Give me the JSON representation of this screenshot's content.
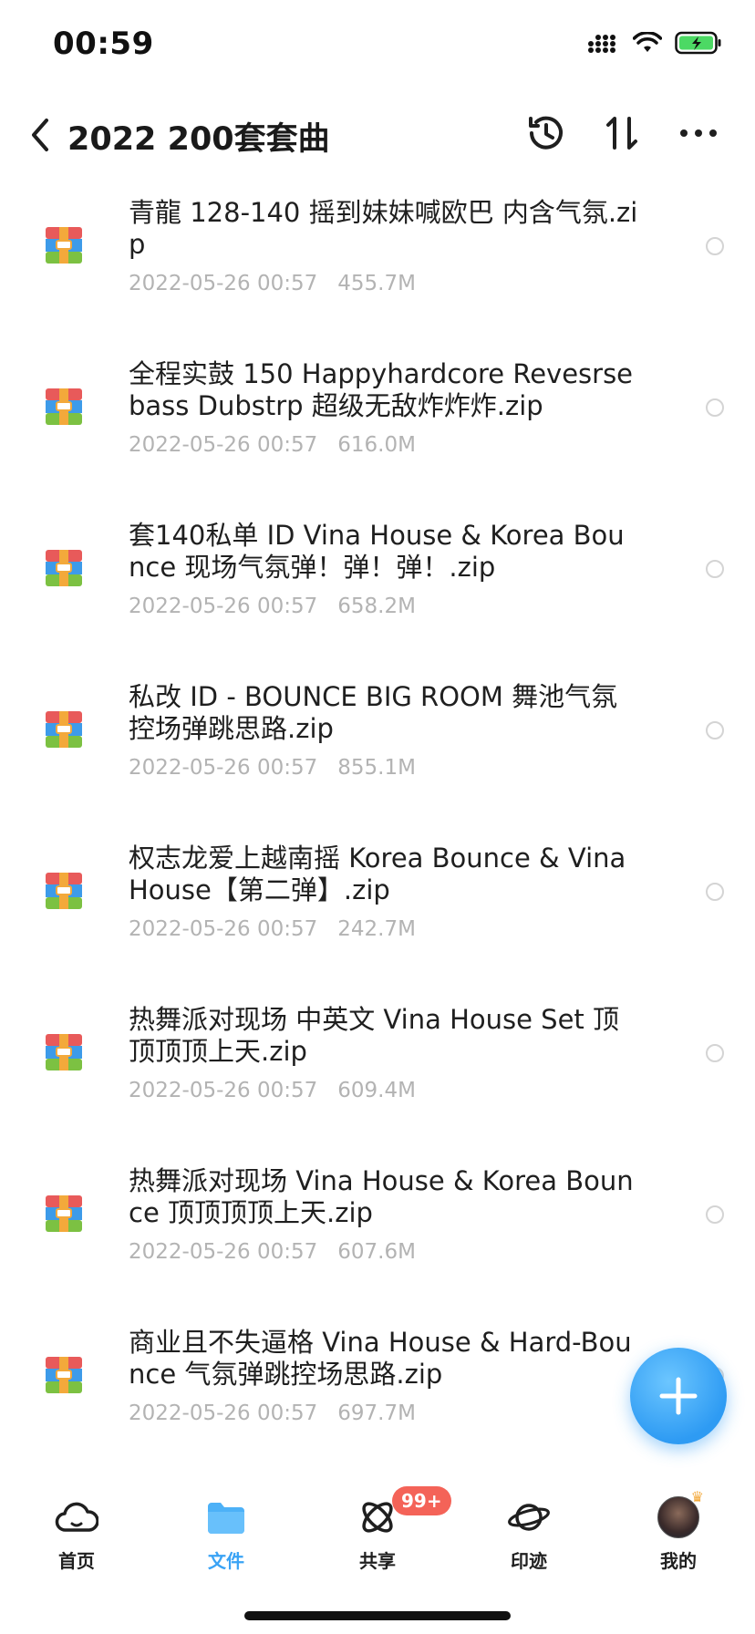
{
  "status_bar": {
    "time": "00:59"
  },
  "header": {
    "title": "2022 200套套曲"
  },
  "files": [
    {
      "name": "青龍 128-140 摇到妹妹喊欧巴 内含气氛.zip",
      "date": "2022-05-26 00:57",
      "size": "455.7M"
    },
    {
      "name": "全程实鼓 150 Happyhardcore Revesrse bass Dubstrp 超级无敌炸炸炸.zip",
      "date": "2022-05-26 00:57",
      "size": "616.0M"
    },
    {
      "name": "套140私单 ID Vina House & Korea Bounce 现场气氛弹！弹！弹！.zip",
      "date": "2022-05-26 00:57",
      "size": "658.2M"
    },
    {
      "name": "私改 ID - BOUNCE BIG ROOM 舞池气氛控场弹跳思路.zip",
      "date": "2022-05-26 00:57",
      "size": "855.1M"
    },
    {
      "name": "权志龙爱上越南摇 Korea Bounce & Vina House【第二弹】.zip",
      "date": "2022-05-26 00:57",
      "size": "242.7M"
    },
    {
      "name": "热舞派对现场 中英文 Vina House Set 顶顶顶顶上天.zip",
      "date": "2022-05-26 00:57",
      "size": "609.4M"
    },
    {
      "name": "热舞派对现场 Vina House & Korea Bounce 顶顶顶顶上天.zip",
      "date": "2022-05-26 00:57",
      "size": "607.6M"
    },
    {
      "name": "商业且不失逼格 Vina House & Hard-Bounce 气氛弹跳控场思路.zip",
      "date": "2022-05-26 00:57",
      "size": "697.7M"
    }
  ],
  "tabs": [
    {
      "label": "首页",
      "icon": "cloud-icon"
    },
    {
      "label": "文件",
      "icon": "folder-icon",
      "active": true
    },
    {
      "label": "共享",
      "icon": "share-orbit-icon",
      "badge": "99+"
    },
    {
      "label": "印迹",
      "icon": "planet-icon"
    },
    {
      "label": "我的",
      "icon": "avatar-icon"
    }
  ],
  "colors": {
    "accent": "#3aa3f5",
    "badge": "#f46358",
    "meta_text": "#b3b3b3",
    "battery": "#4cd964"
  }
}
